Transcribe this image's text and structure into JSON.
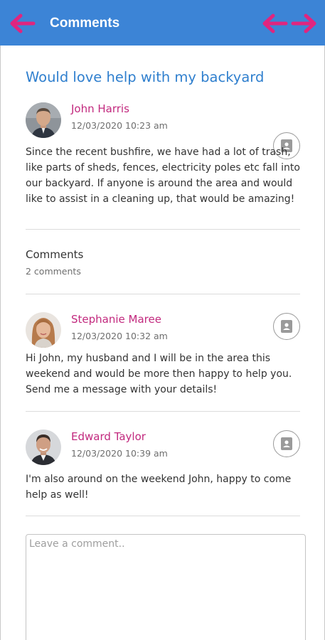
{
  "header": {
    "title": "Comments",
    "background_color": "#3c84d6",
    "arrow_color": "#e0257f",
    "back_icon": "arrow-left-icon",
    "swap_icon": "arrows-left-right-icon"
  },
  "post": {
    "title": "Would love help with my backyard",
    "author": "John Harris",
    "timestamp": "12/03/2020 10:23 am",
    "body": "Since the recent bushfire, we have had a lot of trash, like parts of sheds, fences, electricity poles etc fall into our backyard. If anyone is around the area and would like to assist in a cleaning up, that would be amazing!",
    "action_icon": "contact-card-icon"
  },
  "comments_section": {
    "title": "Comments",
    "count_label": "2 comments",
    "items": [
      {
        "author": "Stephanie Maree",
        "timestamp": "12/03/2020 10:32 am",
        "body": "Hi John, my husband and I will be in the area this weekend and would be more then happy to help you. Send me a message with your details!",
        "action_icon": "contact-card-icon"
      },
      {
        "author": "Edward Taylor",
        "timestamp": "12/03/2020 10:39 am",
        "body": "I'm also around on the weekend John, happy to come help as well!",
        "action_icon": "contact-card-icon"
      }
    ]
  },
  "compose": {
    "placeholder": "Leave a comment..",
    "value": ""
  },
  "colors": {
    "accent_blue": "#2f7fce",
    "name_magenta": "#c2297e"
  }
}
